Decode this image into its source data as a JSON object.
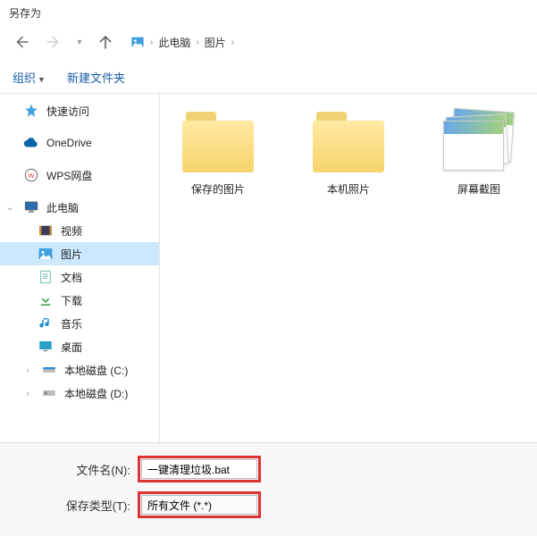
{
  "title": "另存为",
  "breadcrumb": {
    "items": [
      "此电脑",
      "图片"
    ]
  },
  "toolbar": {
    "organize": "组织",
    "new_folder": "新建文件夹"
  },
  "sidebar": {
    "quick_access": "快速访问",
    "onedrive": "OneDrive",
    "wps": "WPS网盘",
    "this_pc": "此电脑",
    "video": "视频",
    "pictures": "图片",
    "documents": "文档",
    "downloads": "下载",
    "music": "音乐",
    "desktop": "桌面",
    "disk_c": "本地磁盘 (C:)",
    "disk_d": "本地磁盘 (D:)"
  },
  "folders": {
    "saved": "保存的图片",
    "camera": "本机照片",
    "screenshots": "屏幕截图"
  },
  "fields": {
    "filename_label": "文件名(N):",
    "filename_value": "一键清理垃圾.bat",
    "type_label": "保存类型(T):",
    "type_value": "所有文件 (*.*)"
  }
}
